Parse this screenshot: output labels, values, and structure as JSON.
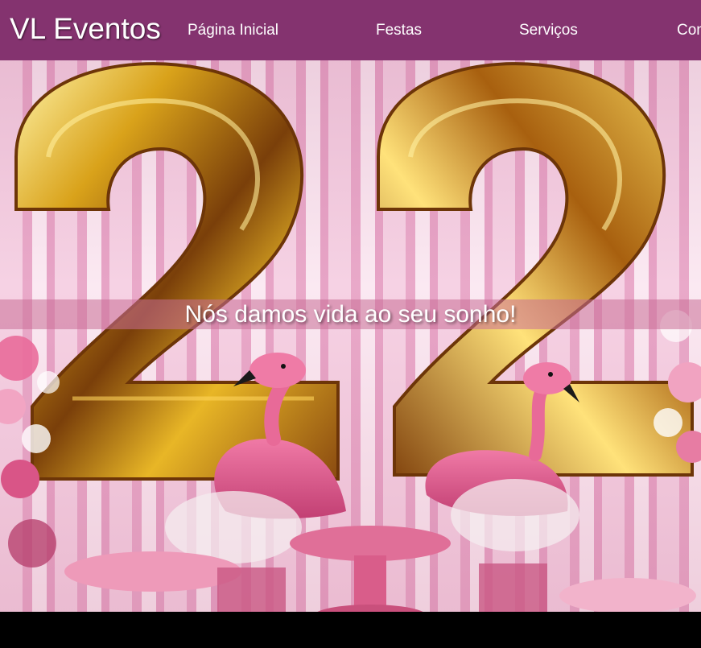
{
  "brand": {
    "name": "VL Eventos"
  },
  "nav": {
    "items": [
      {
        "label": "Página Inicial"
      },
      {
        "label": "Festas"
      },
      {
        "label": "Serviços"
      },
      {
        "label": "Con"
      }
    ]
  },
  "hero": {
    "tagline": "Nós damos vida ao seu sonho!",
    "image_description_icon": "party-photo"
  },
  "colors": {
    "navbar": "#84336f",
    "text": "#ffffff"
  }
}
